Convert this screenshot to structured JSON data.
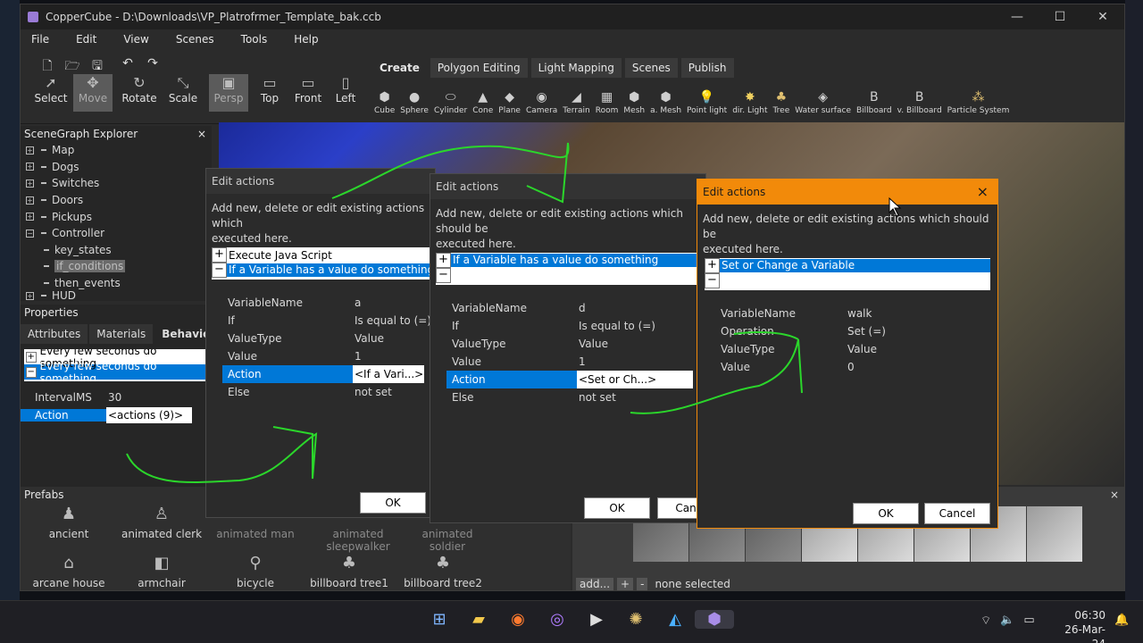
{
  "window": {
    "title": "CopperCube - D:\\Downloads\\VP_Platrofrmer_Template_bak.ccb"
  },
  "menu": [
    "File",
    "Edit",
    "View",
    "Scenes",
    "Tools",
    "Help"
  ],
  "tools": [
    "Select",
    "Move",
    "Rotate",
    "Scale",
    "Persp",
    "Top",
    "Front",
    "Left"
  ],
  "tabs": [
    "Create",
    "Polygon Editing",
    "Light Mapping",
    "Scenes",
    "Publish"
  ],
  "create_items": [
    "Cube",
    "Sphere",
    "Cylinder",
    "Cone",
    "Plane",
    "Camera",
    "Terrain",
    "Room",
    "Mesh",
    "a. Mesh",
    "Point light",
    "dir. Light",
    "Tree",
    "Water surface",
    "Billboard",
    "v. Billboard",
    "Particle System"
  ],
  "scenegraph": {
    "title": "SceneGraph Explorer",
    "close": "×",
    "nodes": [
      "Map",
      "Dogs",
      "Switches",
      "Doors",
      "Pickups",
      "Controller"
    ],
    "children": [
      "key_states",
      "if_conditions",
      "then_events"
    ],
    "partial": "HUD"
  },
  "properties": {
    "title": "Properties",
    "tabs": [
      "Attributes",
      "Materials",
      "Behaviou"
    ],
    "behaviors": [
      "Every few seconds do something",
      "Every few seconds do something"
    ],
    "rows": [
      {
        "k": "IntervalMS",
        "v": "30"
      },
      {
        "k": "Action",
        "v": "<actions (9)>"
      }
    ]
  },
  "prefabs": {
    "title": "Prefabs",
    "items": [
      "ancient",
      "animated clerk",
      "animated man",
      "animated sleepwalker",
      "animated soldier",
      "arcane house",
      "armchair",
      "bicycle",
      "billboard tree1",
      "billboard tree2"
    ]
  },
  "lower": {
    "add": "add...",
    "plus": "+",
    "minus": "-",
    "status": "none selected",
    "close": "×"
  },
  "dialog1": {
    "title": "Edit actions",
    "desc": "Add new, delete or edit existing actions which",
    "desc2": "executed here.",
    "actions": [
      "Execute Java Script",
      "If a Variable has a value do something"
    ],
    "rows": [
      {
        "k": "VariableName",
        "v": "a"
      },
      {
        "k": "If",
        "v": "Is equal to (=)"
      },
      {
        "k": "ValueType",
        "v": "Value"
      },
      {
        "k": "Value",
        "v": "1"
      },
      {
        "k": "Action",
        "v": "<If a Vari...>"
      },
      {
        "k": "Else",
        "v": "not set"
      }
    ],
    "ok": "OK"
  },
  "dialog2": {
    "title": "Edit actions",
    "desc": "Add new, delete or edit existing actions which should be",
    "desc2": "executed here.",
    "actions": [
      "If a Variable has a value do something"
    ],
    "rows": [
      {
        "k": "VariableName",
        "v": "d"
      },
      {
        "k": "If",
        "v": "Is equal to (=)"
      },
      {
        "k": "ValueType",
        "v": "Value"
      },
      {
        "k": "Value",
        "v": "1"
      },
      {
        "k": "Action",
        "v": "<Set or Ch...>"
      },
      {
        "k": "Else",
        "v": "not set"
      }
    ],
    "ok": "OK",
    "cancel": "Cancl"
  },
  "dialog3": {
    "title": "Edit actions",
    "close": "×",
    "desc": "Add new, delete or edit existing actions which should be",
    "desc2": "executed here.",
    "actions": [
      "Set or Change a Variable"
    ],
    "rows": [
      {
        "k": "VariableName",
        "v": "walk"
      },
      {
        "k": "Operation",
        "v": "Set (=)"
      },
      {
        "k": "ValueType",
        "v": "Value"
      },
      {
        "k": "Value",
        "v": "0"
      }
    ],
    "ok": "OK",
    "cancel": "Cancel"
  },
  "taskbar": {
    "time": "06:30",
    "date": "26-Mar-24"
  },
  "colors": {
    "accent": "#f28a0a",
    "selection": "#0078d7",
    "annotation": "#2bd62b"
  }
}
